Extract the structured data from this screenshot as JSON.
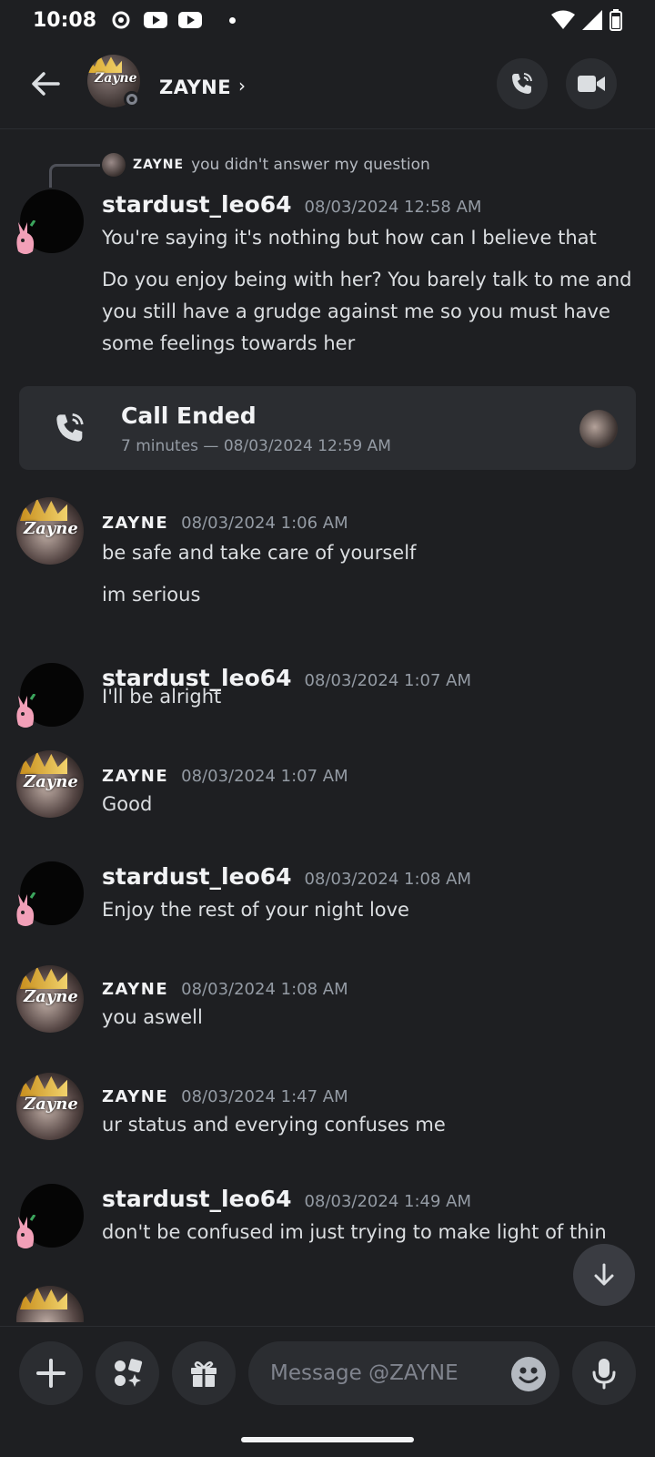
{
  "status_bar": {
    "time": "10:08"
  },
  "header": {
    "contact_name": "ZAYNE",
    "chevron": "›",
    "avatar_text": "Zayne"
  },
  "reply": {
    "name": "ZAYNE",
    "text": "you didn't answer my question"
  },
  "messages": [
    {
      "user": "stardust_leo64",
      "timestamp": "08/03/2024 12:58 AM",
      "lines": [
        "You're saying it's nothing but how can I believe that",
        "Do you enjoy being with her? You barely talk to me and you still have a grudge against me so you must have some feelings towards her"
      ]
    },
    {
      "user": "ZAYNE",
      "timestamp": "08/03/2024 1:06 AM",
      "lines": [
        "be safe and take care of yourself",
        "im serious"
      ]
    },
    {
      "user": "stardust_leo64",
      "timestamp": "08/03/2024 1:07 AM",
      "lines": [
        "I'll be alright"
      ]
    },
    {
      "user": "ZAYNE",
      "timestamp": "08/03/2024 1:07 AM",
      "lines": [
        "Good"
      ]
    },
    {
      "user": "stardust_leo64",
      "timestamp": "08/03/2024 1:08 AM",
      "lines": [
        "Enjoy the rest of your night love"
      ]
    },
    {
      "user": "ZAYNE",
      "timestamp": "08/03/2024 1:08 AM",
      "lines": [
        "you aswell"
      ]
    },
    {
      "user": "ZAYNE",
      "timestamp": "08/03/2024 1:47 AM",
      "lines": [
        "ur status and everying confuses me"
      ]
    },
    {
      "user": "stardust_leo64",
      "timestamp": "08/03/2024 1:49 AM",
      "lines": [
        "don't be confused im just trying to make light of thin"
      ]
    }
  ],
  "call": {
    "title": "Call Ended",
    "subtitle": "7 minutes — 08/03/2024 12:59 AM"
  },
  "input": {
    "placeholder": "Message @ZAYNE"
  },
  "icons": [
    "back-arrow-icon",
    "phone-call-icon",
    "video-camera-icon",
    "plus-icon",
    "apps-icon",
    "gift-icon",
    "emoji-icon",
    "microphone-icon",
    "arrow-down-icon"
  ],
  "colors": {
    "background": "#1e1f22",
    "surface": "#2b2d31",
    "text": "#dbdee1",
    "muted": "#949ba4"
  }
}
